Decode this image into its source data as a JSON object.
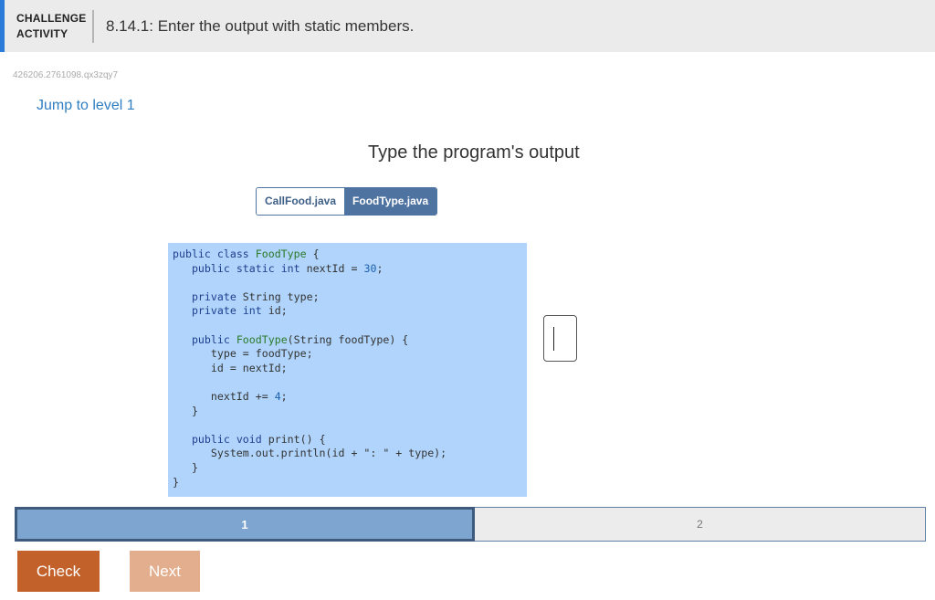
{
  "header": {
    "badge_line1": "CHALLENGE",
    "badge_line2": "ACTIVITY",
    "title": "8.14.1: Enter the output with static members.",
    "accent_color": "#2b7bd9"
  },
  "activity_id": "426206.2761098.qx3zqy7",
  "jump_link": "Jump to level 1",
  "prompt": "Type the program's output",
  "tabs": [
    {
      "label": "CallFood.java",
      "active": false
    },
    {
      "label": "FoodType.java",
      "active": true
    }
  ],
  "code_lines": [
    "public class FoodType {",
    "   public static int nextId = 30;",
    "",
    "   private String type;",
    "   private int id;",
    "",
    "   public FoodType(String foodType) {",
    "      type = foodType;",
    "      id = nextId;",
    "",
    "      nextId += 4;",
    "   }",
    "",
    "   public void print() {",
    "      System.out.println(id + \": \" + type);",
    "   }",
    "}"
  ],
  "answer_box": {
    "value": ""
  },
  "progress": [
    {
      "label": "1",
      "state": "current"
    },
    {
      "label": "2",
      "state": "pending"
    }
  ],
  "buttons": {
    "check": "Check",
    "next": "Next"
  },
  "colors": {
    "code_bg": "#b0d4fb",
    "tab_active": "#4f73a0",
    "check_button": "#c2612a",
    "next_button": "#e2ae8d"
  }
}
